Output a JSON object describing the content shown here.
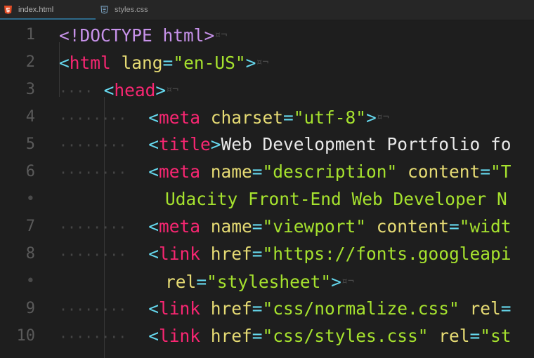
{
  "tabs": [
    {
      "label": "index.html",
      "icon": "html5-icon",
      "active": true
    },
    {
      "label": "styles.css",
      "icon": "css3-icon",
      "active": false
    }
  ],
  "colors": {
    "background": "#1e1e1e",
    "tag": "#f92672",
    "punctuation": "#66d9ef",
    "attribute": "#e6db74",
    "string": "#a6e22e",
    "text": "#e8e8e8",
    "doctype": "#c792ea"
  },
  "lines": [
    {
      "n": "1",
      "ws": "",
      "tokens": [
        {
          "t": "<!DOCTYPE ",
          "c": "decl"
        },
        {
          "t": "html",
          "c": "decl"
        },
        {
          "t": ">",
          "c": "decl"
        }
      ],
      "eol": true
    },
    {
      "n": "2",
      "ws": "",
      "tokens": [
        {
          "t": "<",
          "c": "punct"
        },
        {
          "t": "html",
          "c": "tag"
        },
        {
          "t": " lang",
          "c": "attr"
        },
        {
          "t": "=",
          "c": "punct"
        },
        {
          "t": "\"en-US\"",
          "c": "str"
        },
        {
          "t": ">",
          "c": "punct"
        }
      ],
      "eol": true
    },
    {
      "n": "3",
      "ws": "····",
      "tokens": [
        {
          "t": "<",
          "c": "punct"
        },
        {
          "t": "head",
          "c": "tag"
        },
        {
          "t": ">",
          "c": "punct"
        }
      ],
      "eol": true
    },
    {
      "n": "4",
      "ws": "········",
      "tokens": [
        {
          "t": "<",
          "c": "punct"
        },
        {
          "t": "meta",
          "c": "tag"
        },
        {
          "t": " charset",
          "c": "attr"
        },
        {
          "t": "=",
          "c": "punct"
        },
        {
          "t": "\"utf-8\"",
          "c": "str"
        },
        {
          "t": ">",
          "c": "punct"
        }
      ],
      "eol": true
    },
    {
      "n": "5",
      "ws": "········",
      "tokens": [
        {
          "t": "<",
          "c": "punct"
        },
        {
          "t": "title",
          "c": "tag"
        },
        {
          "t": ">",
          "c": "punct"
        },
        {
          "t": "Web Development Portfolio fo",
          "c": "text"
        }
      ],
      "eol": false
    },
    {
      "n": "6",
      "ws": "········",
      "tokens": [
        {
          "t": "<",
          "c": "punct"
        },
        {
          "t": "meta",
          "c": "tag"
        },
        {
          "t": " name",
          "c": "attr"
        },
        {
          "t": "=",
          "c": "punct"
        },
        {
          "t": "\"description\"",
          "c": "str"
        },
        {
          "t": " content",
          "c": "attr"
        },
        {
          "t": "=",
          "c": "punct"
        },
        {
          "t": "\"T",
          "c": "str"
        }
      ],
      "eol": false
    },
    {
      "n": "•",
      "ws": "",
      "indent": 9.5,
      "tokens": [
        {
          "t": "Udacity Front-End Web Developer N",
          "c": "str"
        }
      ],
      "eol": false
    },
    {
      "n": "7",
      "ws": "········",
      "tokens": [
        {
          "t": "<",
          "c": "punct"
        },
        {
          "t": "meta",
          "c": "tag"
        },
        {
          "t": " name",
          "c": "attr"
        },
        {
          "t": "=",
          "c": "punct"
        },
        {
          "t": "\"viewport\"",
          "c": "str"
        },
        {
          "t": " content",
          "c": "attr"
        },
        {
          "t": "=",
          "c": "punct"
        },
        {
          "t": "\"widt",
          "c": "str"
        }
      ],
      "eol": false
    },
    {
      "n": "8",
      "ws": "········",
      "tokens": [
        {
          "t": "<",
          "c": "punct"
        },
        {
          "t": "link",
          "c": "tag"
        },
        {
          "t": " href",
          "c": "attr"
        },
        {
          "t": "=",
          "c": "punct"
        },
        {
          "t": "\"https://fonts.googleapi",
          "c": "str"
        }
      ],
      "eol": false
    },
    {
      "n": "•",
      "ws": "",
      "indent": 9.5,
      "tokens": [
        {
          "t": "rel",
          "c": "attr"
        },
        {
          "t": "=",
          "c": "punct"
        },
        {
          "t": "\"stylesheet\"",
          "c": "str"
        },
        {
          "t": ">",
          "c": "punct"
        }
      ],
      "eol": true
    },
    {
      "n": "9",
      "ws": "········",
      "tokens": [
        {
          "t": "<",
          "c": "punct"
        },
        {
          "t": "link",
          "c": "tag"
        },
        {
          "t": " href",
          "c": "attr"
        },
        {
          "t": "=",
          "c": "punct"
        },
        {
          "t": "\"css/normalize.css\"",
          "c": "str"
        },
        {
          "t": " rel",
          "c": "attr"
        },
        {
          "t": "=",
          "c": "punct"
        }
      ],
      "eol": false
    },
    {
      "n": "10",
      "ws": "········",
      "tokens": [
        {
          "t": "<",
          "c": "punct"
        },
        {
          "t": "link",
          "c": "tag"
        },
        {
          "t": " href",
          "c": "attr"
        },
        {
          "t": "=",
          "c": "punct"
        },
        {
          "t": "\"css/styles.css\"",
          "c": "str"
        },
        {
          "t": " rel",
          "c": "attr"
        },
        {
          "t": "=",
          "c": "punct"
        },
        {
          "t": "\"st",
          "c": "str"
        }
      ],
      "eol": false
    }
  ],
  "eol_marker": "¤¬"
}
